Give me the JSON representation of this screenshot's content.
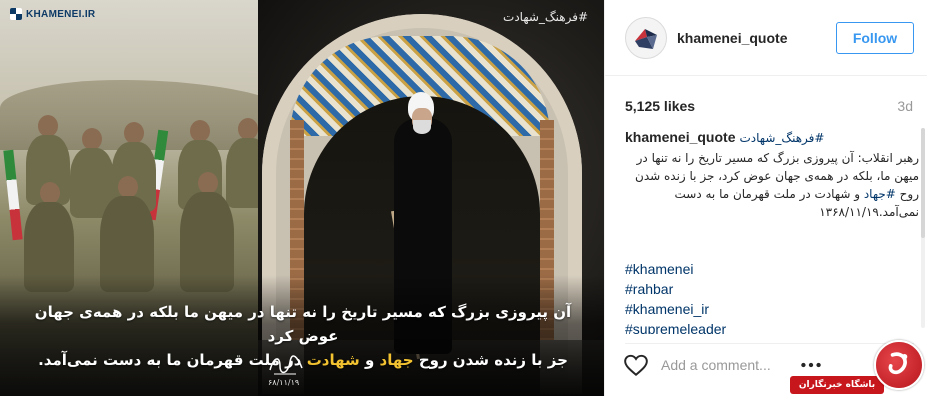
{
  "image": {
    "logo_text": "KHAMENEI.IR",
    "hashtag": "#فرهنگ_شهادت",
    "quote_line1": "آن پیروزی بزرگ که مسیر تاریخ را نه تنها در میهن ما بلکه در همه‌ی جهان عوض کرد",
    "quote_line2_part1": "جز با زنده شدن روح ",
    "quote_line2_jihad": "جهاد",
    "quote_line2_and": " و ",
    "quote_line2_martyrdom": "شهادت",
    "quote_line2_part2": " در ملت قهرمان ما به دست نمی‌آمد.",
    "signature_date": "۶۸/۱۱/۱۹"
  },
  "header": {
    "username": "khamenei_quote",
    "follow_label": "Follow"
  },
  "stats": {
    "likes": "5,125 likes",
    "time": "3d"
  },
  "caption": {
    "username": "khamenei_quote",
    "hashtag": "#فرهنگ_شهادت",
    "body_part1": "رهبر انقلاب: آن پیروزی بزرگ که مسیر تاریخ را نه تنها در میهن ما، بلکه در همه‌ی جهان عوض کرد، جز با زنده شدن روح ",
    "body_link": "#جهاد",
    "body_part2": " و شهادت در ملت قهرمان ما به دست نمی‌آمد.۱۳۶۸/۱۱/۱۹"
  },
  "tags": [
    "#khamenei",
    "#rahbar",
    "#khamenei_ir",
    "#supremeleader"
  ],
  "footer": {
    "comment_placeholder": "Add a comment..."
  },
  "watermark": {
    "label": "باشگاه خبرنگاران"
  },
  "colors": {
    "follow_blue": "#3897f0",
    "link_blue": "#003569",
    "highlight_yellow": "#f2c230",
    "watermark_red": "#c8161d"
  },
  "icons": [
    "heart-icon",
    "more-options-icon",
    "logo-icon",
    "avatar-icon",
    "signature-icon",
    "watermark-logo-icon"
  ]
}
